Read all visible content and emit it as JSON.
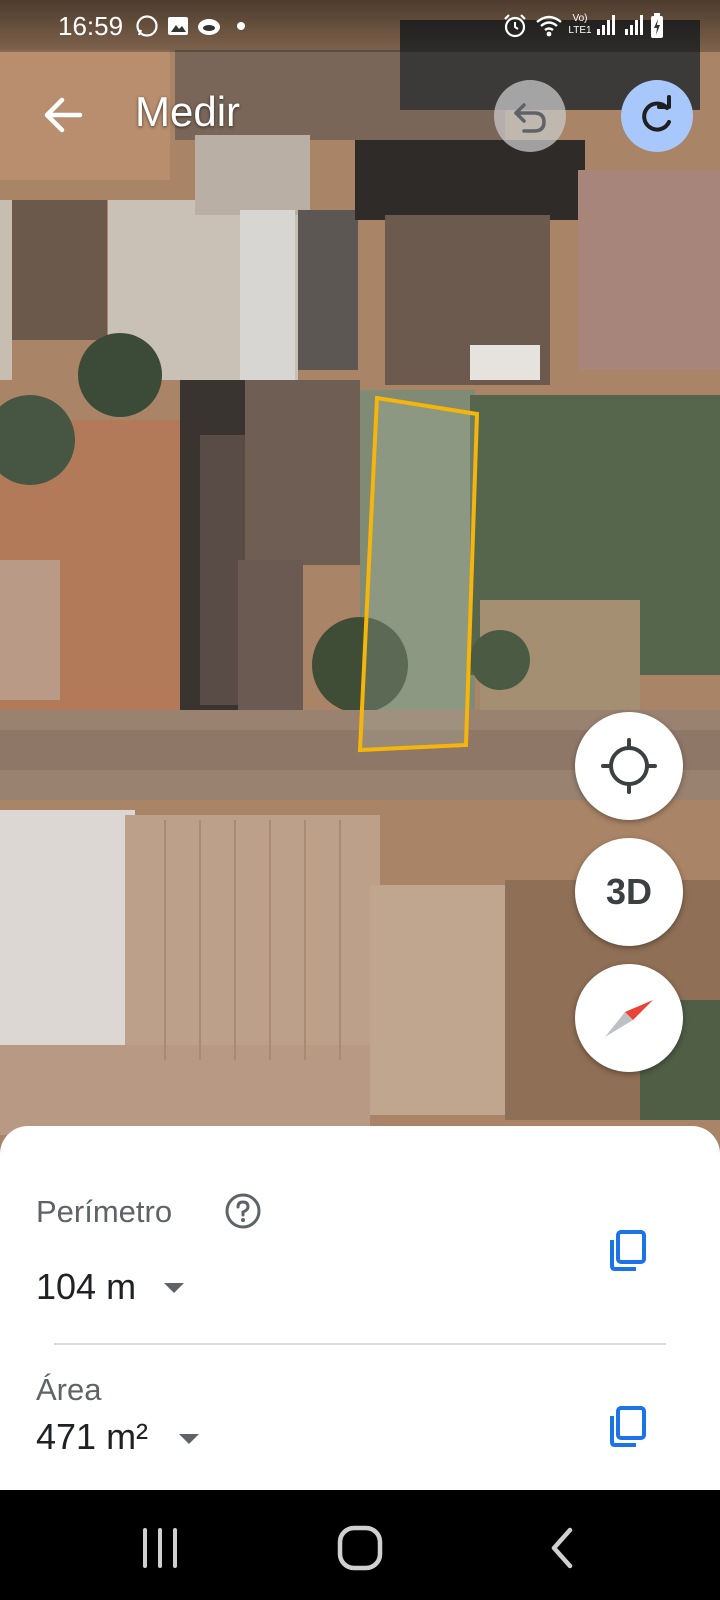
{
  "status_bar": {
    "time": "16:59",
    "left_icons": [
      "whatsapp-icon",
      "image-icon",
      "cloud-icon",
      "dot-icon"
    ],
    "right_icons": [
      "alarm-icon",
      "wifi-icon",
      "volte-icon",
      "signal-icon",
      "signal-icon",
      "battery-charging-icon"
    ],
    "volte_label_top": "Vo)",
    "volte_label_bottom": "LTE1"
  },
  "top_bar": {
    "title": "Medir",
    "back_icon": "arrow-back-icon",
    "undo_icon": "undo-icon",
    "redo_icon": "redo-icon"
  },
  "map_controls": {
    "location_icon": "my-location-icon",
    "threed_label": "3D",
    "compass_icon": "compass-icon"
  },
  "measurement": {
    "perimeter_label": "Perímetro",
    "perimeter_value": "104 m",
    "area_label": "Área",
    "area_value": "471 m²",
    "help_icon": "help-icon",
    "copy_icon": "copy-icon",
    "dropdown_icon": "caret-down-icon"
  },
  "colors": {
    "measure_outline": "#f5b50a",
    "redo_button": "#a8c7fa",
    "copy_icon": "#1a73e8"
  },
  "nav_bar": {
    "icons": [
      "recent-apps-icon",
      "home-icon",
      "back-icon"
    ]
  }
}
